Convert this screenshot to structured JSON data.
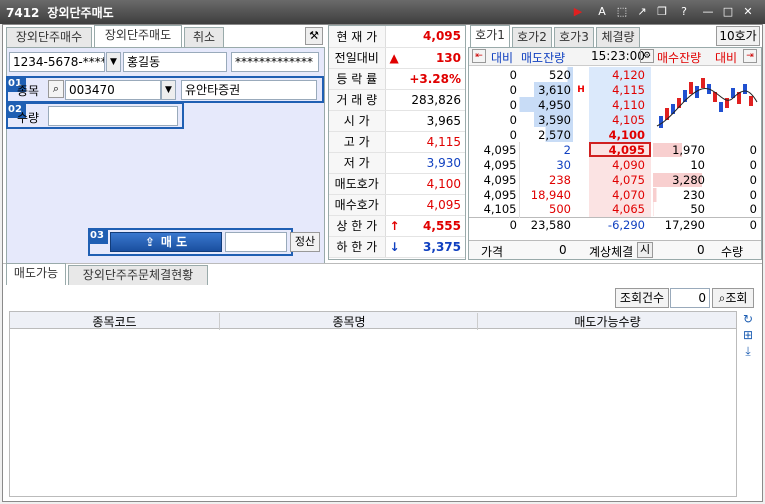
{
  "title": {
    "code": "7412",
    "name": "장외단주매도"
  },
  "toolbar_icons": [
    "play-icon",
    "text-size-icon",
    "export-icon",
    "link-icon",
    "window-icon",
    "help-icon",
    "minimize-icon",
    "maximize-icon",
    "close-icon"
  ],
  "left_tabs": [
    "장외단주매수",
    "장외단주매도",
    "취소"
  ],
  "account": {
    "number": "1234-5678-*****",
    "name": "홍길동",
    "password": "*************"
  },
  "stock": {
    "label": "종목",
    "code": "003470",
    "name": "유안타증권"
  },
  "qty": {
    "label": "수량",
    "value": ""
  },
  "badges": [
    "01",
    "02",
    "03"
  ],
  "sell_button": "매 도",
  "settle_button": "정산",
  "quote": [
    {
      "label": "현 재 가",
      "value": "4,095",
      "cls": "red bold"
    },
    {
      "label": "전일대비",
      "mark": "▲",
      "value": "130",
      "cls": "red bold"
    },
    {
      "label": "등 락 률",
      "value": "+3.28%",
      "cls": "red bold"
    },
    {
      "label": "거 래 량",
      "value": "283,826",
      "cls": ""
    },
    {
      "label": "시 가",
      "value": "3,965",
      "cls": ""
    },
    {
      "label": "고 가",
      "value": "4,115",
      "cls": "red"
    },
    {
      "label": "저 가",
      "value": "3,930",
      "cls": "blue"
    },
    {
      "label": "매도호가",
      "value": "4,100",
      "cls": "red"
    },
    {
      "label": "매수호가",
      "value": "4,095",
      "cls": "red"
    },
    {
      "label": "상 한 가",
      "mark": "↑",
      "value": "4,555",
      "cls": "red bold"
    },
    {
      "label": "하 한 가",
      "mark": "↓",
      "value": "3,375",
      "cls": "blue bold"
    }
  ],
  "hoga_tabs": [
    "호가1",
    "호가2",
    "호가3",
    "체결량"
  ],
  "hoga_mode": "10호가",
  "hoga_header": {
    "diff": "대비",
    "ask_rem": "매도잔량",
    "time": "15:23:00",
    "bid_rem": "매수잔량",
    "diff2": "대비"
  },
  "asks": [
    {
      "diff": "0",
      "rem": "520",
      "price": "4,120"
    },
    {
      "diff": "0",
      "rem": "3,610",
      "price": "4,115",
      "mark": "H"
    },
    {
      "diff": "0",
      "rem": "4,950",
      "price": "4,110"
    },
    {
      "diff": "0",
      "rem": "3,590",
      "price": "4,105"
    },
    {
      "diff": "0",
      "rem": "2,570",
      "price": "4,100"
    }
  ],
  "bids": [
    {
      "p": "4,095",
      "q": "2",
      "price": "4,095",
      "rem": "1,970",
      "diff": "0"
    },
    {
      "p": "4,095",
      "q": "30",
      "price": "4,090",
      "rem": "10",
      "diff": "0"
    },
    {
      "p": "4,095",
      "q": "238",
      "price": "4,075",
      "rem": "3,280",
      "diff": "0"
    },
    {
      "p": "4,095",
      "q": "18,940",
      "price": "4,070",
      "rem": "230",
      "diff": "0"
    },
    {
      "p": "4,105",
      "q": "500",
      "price": "4,065",
      "rem": "50",
      "diff": "0"
    }
  ],
  "totals": {
    "diff": "0",
    "ask": "23,580",
    "net": "-6,290",
    "bid": "17,290",
    "diff2": "0"
  },
  "calc": {
    "price_label": "가격",
    "price": "0",
    "label": "계상체결",
    "btn": "시",
    "qty": "0",
    "qty_label": "수량"
  },
  "bottom_tabs": [
    "매도가능",
    "장외단주주문체결현황"
  ],
  "query": {
    "label": "조회건수",
    "count": "0",
    "button": "조회"
  },
  "table_headers": [
    "종목코드",
    "종목명",
    "매도가능수량"
  ]
}
